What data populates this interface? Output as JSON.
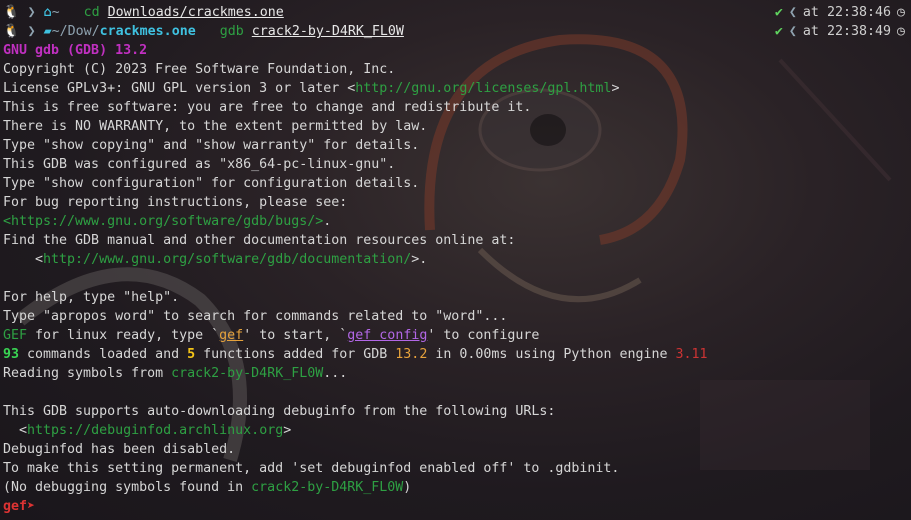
{
  "prompt1": {
    "home_icon": "home-icon",
    "dir": "~",
    "cmd": "cd",
    "arg": "Downloads/crackmes.one",
    "status": "✔",
    "at": "at 22:38:46",
    "clock_icon": "clock-icon"
  },
  "prompt2": {
    "folder_icon": "folder-icon",
    "dir_prefix": "~/Dow/",
    "dir_bold": "crackmes.one",
    "cmd": "gdb",
    "arg": "crack2-by-D4RK_FL0W",
    "status": "✔",
    "at": "at 22:38:49",
    "clock_icon": "clock-icon"
  },
  "gdb": {
    "banner": "GNU gdb (GDB) 13.2",
    "copyright": "Copyright (C) 2023 Free Software Foundation, Inc.",
    "license_pre": "License GPLv3+: GNU GPL version 3 or later <",
    "license_url": "http://gnu.org/licenses/gpl.html",
    "license_post": ">",
    "free": "This is free software: you are free to change and redistribute it.",
    "warranty": "There is NO WARRANTY, to the extent permitted by law.",
    "show": "Type \"show copying\" and \"show warranty\" for details.",
    "configured": "This GDB was configured as \"x86_64-pc-linux-gnu\".",
    "config": "Type \"show configuration\" for configuration details.",
    "bugs": "For bug reporting instructions, please see:",
    "bugs_url": "<https://www.gnu.org/software/gdb/bugs/>",
    "bugs_post": ".",
    "manual": "Find the GDB manual and other documentation resources online at:",
    "manual_pre": "    <",
    "manual_url": "http://www.gnu.org/software/gdb/documentation/",
    "manual_post": ">.",
    "help": "For help, type \"help\".",
    "apropos": "Type \"apropos word\" to search for commands related to \"word\"...",
    "gef_name": "GEF",
    "gef_mid1": " for linux ready, type `",
    "gef_cmd": "gef",
    "gef_mid2": "' to start, `",
    "gef_config": "gef config",
    "gef_end": "' to configure",
    "cmds_count": "93",
    "cmds_mid": " commands loaded and ",
    "funcs_count": "5",
    "funcs_mid": " functions added for GDB ",
    "gdb_ver": "13.2",
    "time_mid": " in 0.00ms using Python engine ",
    "py_ver": "3.11",
    "reading_pre": "Reading symbols from ",
    "reading_file": "crack2-by-D4RK_FL0W",
    "reading_post": "...",
    "debuginfod": "This GDB supports auto-downloading debuginfo from the following URLs:",
    "debuginfod_pre": "  <",
    "debuginfod_url": "https://debuginfod.archlinux.org",
    "debuginfod_post": ">",
    "disabled": "Debuginfod has been disabled.",
    "permanent": "To make this setting permanent, add 'set debuginfod enabled off' to .gdbinit.",
    "nodebug_pre": "(No debugging symbols found in ",
    "nodebug_file": "crack2-by-D4RK_FL0W",
    "nodebug_post": ")",
    "prompt": "gef➤"
  }
}
